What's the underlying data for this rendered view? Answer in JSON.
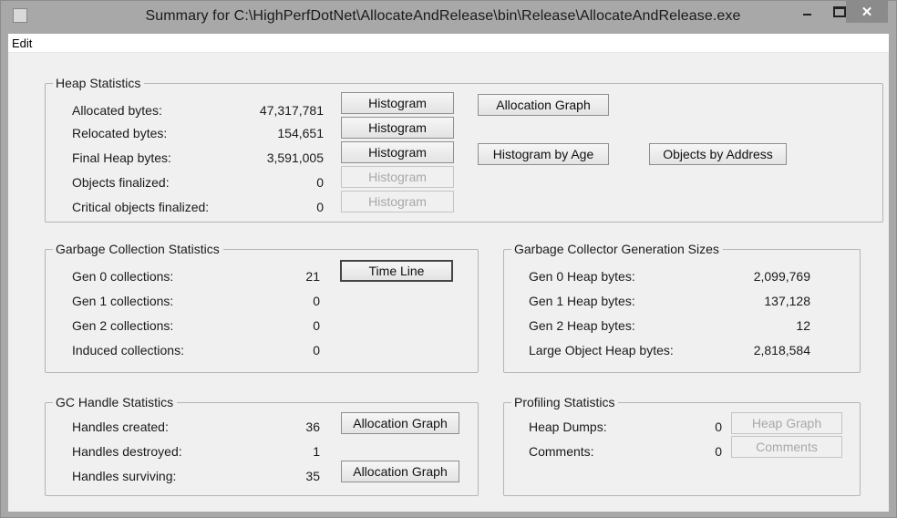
{
  "window": {
    "title": "Summary for C:\\HighPerfDotNet\\AllocateAndRelease\\bin\\Release\\AllocateAndRelease.exe",
    "close_glyph": "✕"
  },
  "menu": {
    "edit": "Edit"
  },
  "heap": {
    "title": "Heap Statistics",
    "rows": [
      {
        "label": "Allocated bytes:",
        "value": "47,317,781",
        "button": "Histogram"
      },
      {
        "label": "Relocated bytes:",
        "value": "154,651",
        "button": "Histogram"
      },
      {
        "label": "Final Heap bytes:",
        "value": "3,591,005",
        "button": "Histogram"
      },
      {
        "label": "Objects finalized:",
        "value": "0",
        "button": "Histogram"
      },
      {
        "label": "Critical objects finalized:",
        "value": "0",
        "button": "Histogram"
      }
    ],
    "allocation_graph": "Allocation Graph",
    "histogram_by_age": "Histogram by Age",
    "objects_by_address": "Objects by Address"
  },
  "gc": {
    "title": "Garbage Collection Statistics",
    "rows": [
      {
        "label": "Gen 0 collections:",
        "value": "21"
      },
      {
        "label": "Gen 1 collections:",
        "value": "0"
      },
      {
        "label": "Gen 2 collections:",
        "value": "0"
      },
      {
        "label": "Induced collections:",
        "value": "0"
      }
    ],
    "timeline": "Time Line"
  },
  "gen_sizes": {
    "title": "Garbage Collector Generation Sizes",
    "rows": [
      {
        "label": "Gen 0 Heap bytes:",
        "value": "2,099,769"
      },
      {
        "label": "Gen 1 Heap bytes:",
        "value": "137,128"
      },
      {
        "label": "Gen 2 Heap bytes:",
        "value": "12"
      },
      {
        "label": "Large Object Heap bytes:",
        "value": "2,818,584"
      }
    ]
  },
  "handles": {
    "title": "GC Handle Statistics",
    "rows": [
      {
        "label": "Handles created:",
        "value": "36",
        "button": "Allocation Graph"
      },
      {
        "label": "Handles destroyed:",
        "value": "1"
      },
      {
        "label": "Handles surviving:",
        "value": "35",
        "button": "Allocation Graph"
      }
    ]
  },
  "profiling": {
    "title": "Profiling Statistics",
    "rows": [
      {
        "label": "Heap Dumps:",
        "value": "0",
        "button": "Heap Graph"
      },
      {
        "label": "Comments:",
        "value": "0",
        "button": "Comments"
      }
    ]
  }
}
